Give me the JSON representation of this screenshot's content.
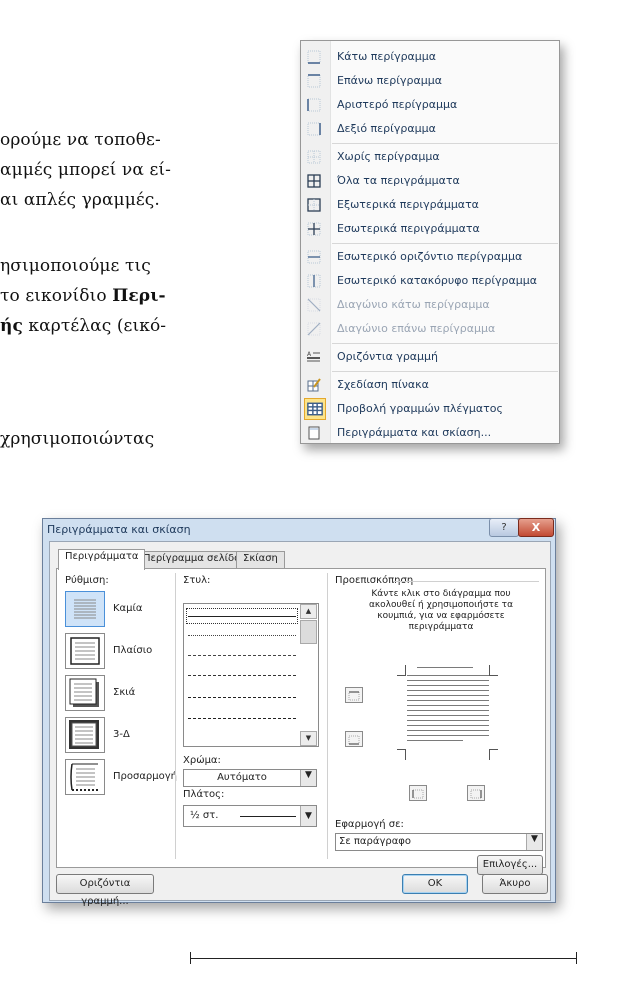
{
  "book_text": {
    "lines": [
      "ορούμε να τοποθε-",
      "αμμές μπορεί να εί-",
      "αι απλές γραμμές.",
      "ησιμοποιούμε τις",
      "το εικονίδιο ",
      "ής",
      " καρτέλας (εικό-",
      "χρησιμοποιώντας"
    ],
    "bold_fragment": "Περι-"
  },
  "menu": {
    "items": [
      {
        "label": "Κάτω περίγραμμα",
        "icon": "border-bottom-icon",
        "enabled": true
      },
      {
        "label": "Επάνω περίγραμμα",
        "icon": "border-top-icon",
        "enabled": true
      },
      {
        "label": "Αριστερό περίγραμμα",
        "icon": "border-left-icon",
        "enabled": true
      },
      {
        "label": "Δεξιό περίγραμμα",
        "icon": "border-right-icon",
        "enabled": true
      },
      {
        "label": "Χωρίς περίγραμμα",
        "icon": "no-border-icon",
        "enabled": true
      },
      {
        "label": "Όλα τα περιγράμματα",
        "icon": "all-borders-icon",
        "enabled": true
      },
      {
        "label": "Εξωτερικά περιγράμματα",
        "icon": "outside-borders-icon",
        "enabled": true
      },
      {
        "label": "Εσωτερικά περιγράμματα",
        "icon": "inside-borders-icon",
        "enabled": true
      },
      {
        "label": "Εσωτερικό οριζόντιο περίγραμμα",
        "icon": "inside-horizontal-border-icon",
        "enabled": true
      },
      {
        "label": "Εσωτερικό κατακόρυφο περίγραμμα",
        "icon": "inside-vertical-border-icon",
        "enabled": true
      },
      {
        "label": "Διαγώνιο κάτω περίγραμμα",
        "icon": "diagonal-down-border-icon",
        "enabled": false
      },
      {
        "label": "Διαγώνιο επάνω περίγραμμα",
        "icon": "diagonal-up-border-icon",
        "enabled": false
      },
      {
        "label": "Οριζόντια γραμμή",
        "icon": "horizontal-line-icon",
        "enabled": true
      },
      {
        "label": "Σχεδίαση πίνακα",
        "icon": "draw-table-icon",
        "enabled": true
      },
      {
        "label": "Προβολή γραμμών πλέγματος",
        "icon": "view-gridlines-icon",
        "enabled": true,
        "highlighted": true
      },
      {
        "label": "Περιγράμματα και σκίαση...",
        "icon": "borders-shading-icon",
        "enabled": true
      }
    ]
  },
  "dialog": {
    "title": "Περιγράμματα και σκίαση",
    "help": "?",
    "close": "X",
    "tabs": [
      "Περιγράμματα",
      "Περίγραμμα σελίδας",
      "Σκίαση"
    ],
    "setting_label": "Ρύθμιση:",
    "settings": [
      "Καμία",
      "Πλαίσιο",
      "Σκιά",
      "3-Δ",
      "Προσαρμογή"
    ],
    "style_label": "Στυλ:",
    "color_label": "Χρώμα:",
    "color_value": "Αυτόματο",
    "width_label": "Πλάτος:",
    "width_value": "½ στ.",
    "preview_label": "Προεπισκόπηση",
    "preview_hint": [
      "Κάντε κλικ στο διάγραμμα που",
      "ακολουθεί ή χρησιμοποιήστε τα",
      "κουμπιά, για να εφαρμόσετε",
      "περιγράμματα"
    ],
    "apply_label": "Εφαρμογή σε:",
    "apply_value": "Σε παράγραφο",
    "options_button": "Επιλογές...",
    "horizontal_line_button": "Οριζόντια γραμμή...",
    "ok_button": "OK",
    "cancel_button": "Άκυρο"
  }
}
